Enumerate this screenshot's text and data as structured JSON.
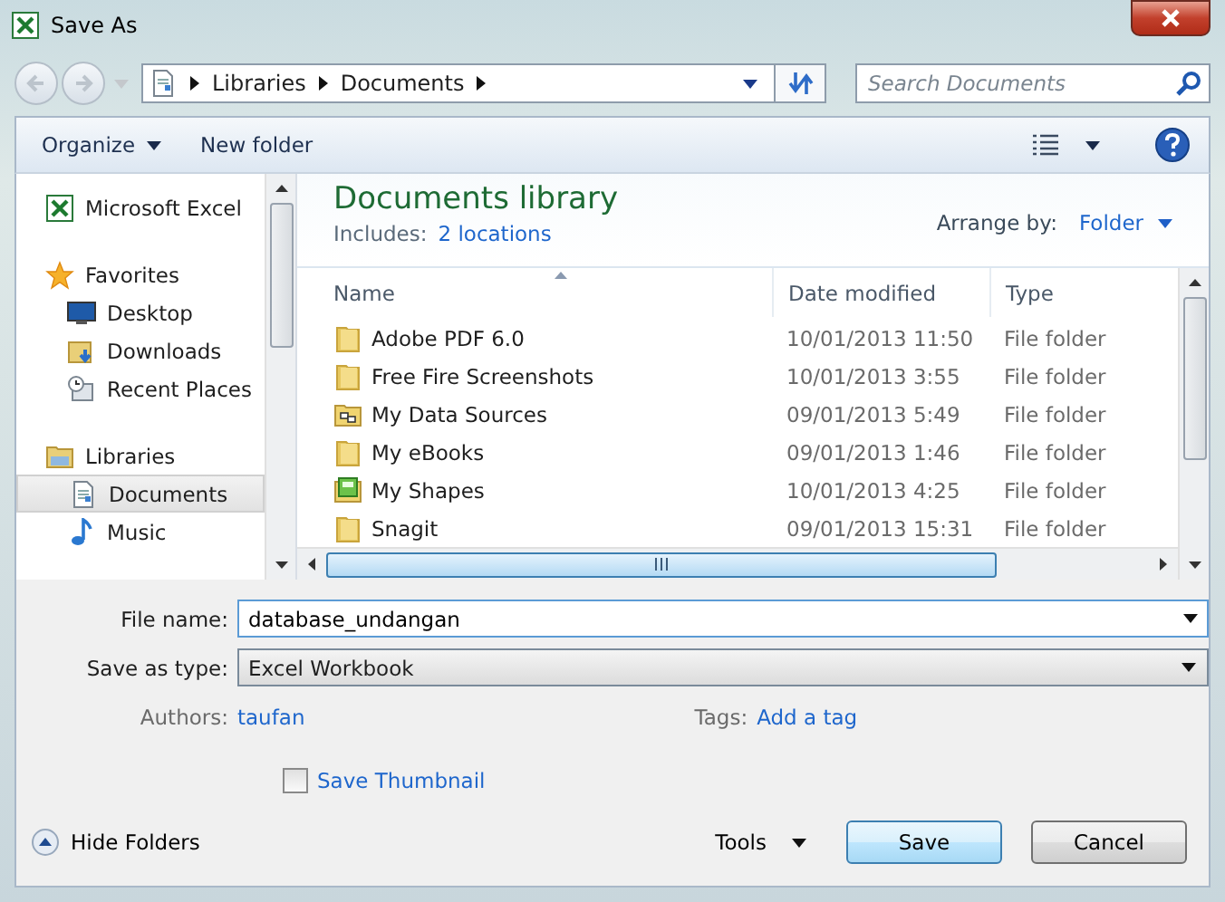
{
  "window": {
    "title": "Save As"
  },
  "address": {
    "path": [
      "Libraries",
      "Documents"
    ]
  },
  "search": {
    "placeholder": "Search Documents"
  },
  "toolbar": {
    "organize": "Organize",
    "new_folder": "New folder"
  },
  "nav": [
    {
      "label": "Microsoft Excel",
      "kind": "excel",
      "selected": false
    },
    {
      "label": "Favorites",
      "kind": "star",
      "selected": false,
      "children": [
        {
          "label": "Desktop",
          "kind": "desktop",
          "selected": false
        },
        {
          "label": "Downloads",
          "kind": "downloads",
          "selected": false
        },
        {
          "label": "Recent Places",
          "kind": "recent",
          "selected": false
        }
      ]
    },
    {
      "label": "Libraries",
      "kind": "libraries",
      "selected": false,
      "children": [
        {
          "label": "Documents",
          "kind": "document",
          "selected": true
        },
        {
          "label": "Music",
          "kind": "music",
          "selected": false
        }
      ]
    }
  ],
  "library": {
    "title": "Documents library",
    "includes_label": "Includes:",
    "includes_link": "2 locations",
    "arrange_label": "Arrange by:",
    "arrange_value": "Folder"
  },
  "table": {
    "columns": [
      "Name",
      "Date modified",
      "Type"
    ],
    "rows": [
      {
        "name": "Adobe PDF 6.0",
        "date": "10/01/2013 11:50",
        "type": "File folder",
        "kind": "folder"
      },
      {
        "name": "Free Fire Screenshots",
        "date": "10/01/2013 3:55",
        "type": "File folder",
        "kind": "folder"
      },
      {
        "name": "My Data Sources",
        "date": "09/01/2013 5:49",
        "type": "File folder",
        "kind": "data"
      },
      {
        "name": "My eBooks",
        "date": "09/01/2013 1:46",
        "type": "File folder",
        "kind": "folder"
      },
      {
        "name": "My Shapes",
        "date": "10/01/2013 4:25",
        "type": "File folder",
        "kind": "shapes"
      },
      {
        "name": "Snagit",
        "date": "09/01/2013 15:31",
        "type": "File folder",
        "kind": "folder"
      }
    ]
  },
  "form": {
    "file_name_label": "File name:",
    "file_name": "database_undangan",
    "type_label": "Save as type:",
    "type_value": "Excel Workbook",
    "authors_label": "Authors:",
    "authors": "taufan",
    "tags_label": "Tags:",
    "tags_value": "Add a tag",
    "thumbnail": {
      "label": "Save Thumbnail",
      "checked": false
    }
  },
  "footer": {
    "hide_folders": "Hide Folders",
    "tools": "Tools",
    "save": "Save",
    "cancel": "Cancel"
  }
}
